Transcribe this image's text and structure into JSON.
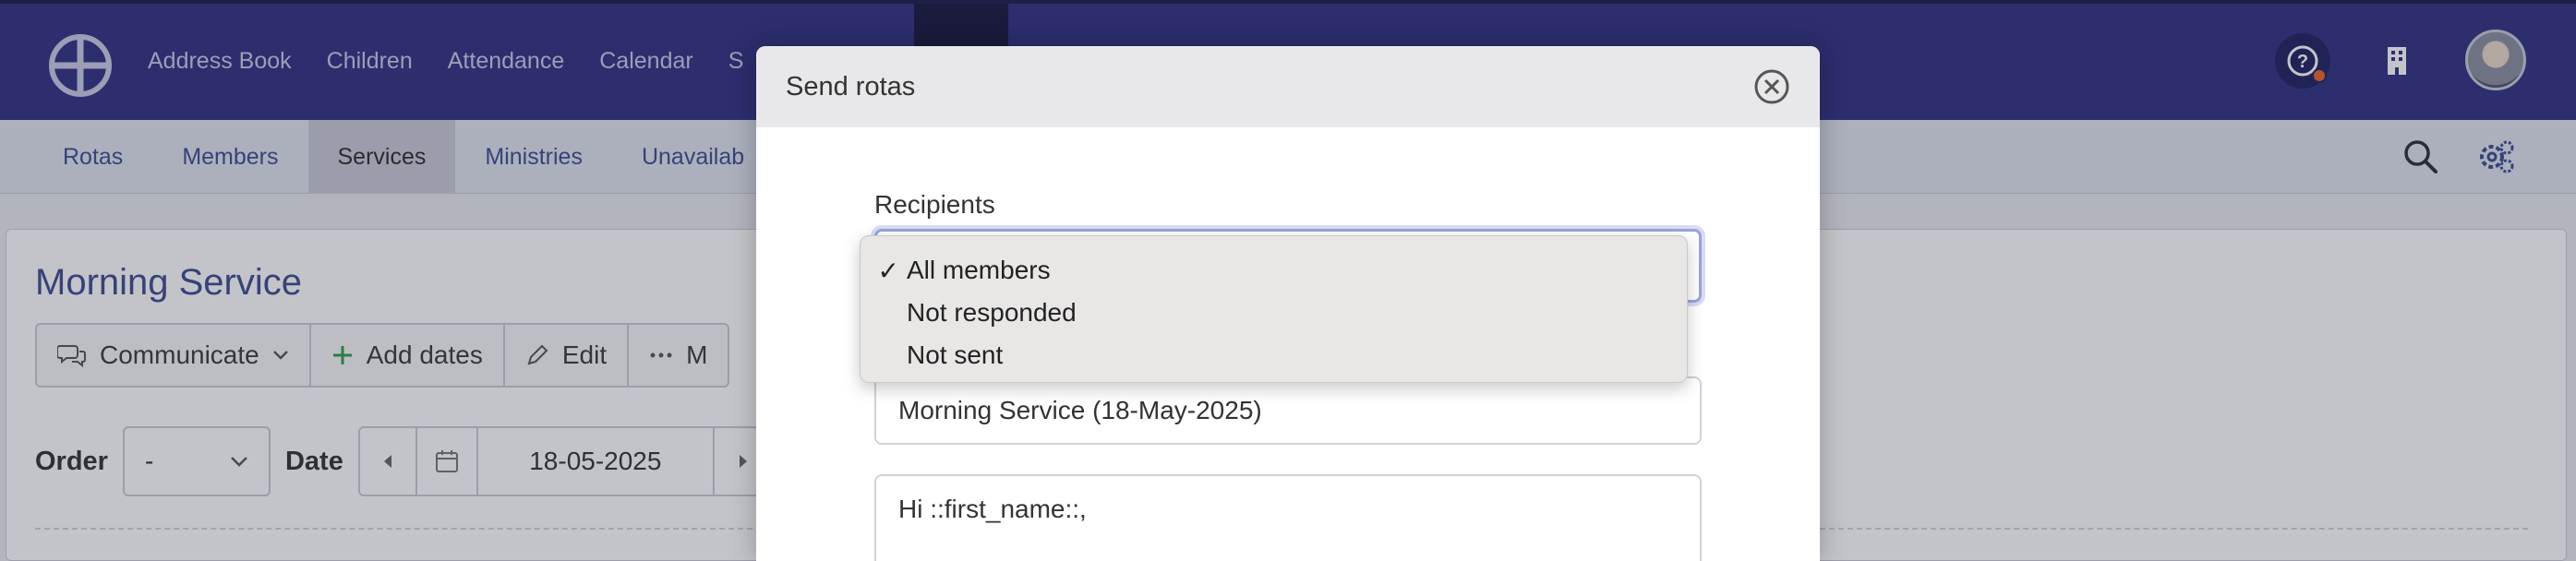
{
  "topnav": {
    "items": [
      "Address Book",
      "Children",
      "Attendance",
      "Calendar",
      "S"
    ]
  },
  "subnav": {
    "tabs": [
      "Rotas",
      "Members",
      "Services",
      "Ministries",
      "Unavailab"
    ],
    "active_index": 2
  },
  "page": {
    "title": "Morning Service",
    "toolbar": {
      "communicate": "Communicate",
      "add_dates": "Add dates",
      "edit": "Edit",
      "more": "M"
    },
    "filters": {
      "order_label": "Order",
      "order_value": "-",
      "date_label": "Date",
      "date_value": "18-05-2025"
    }
  },
  "modal": {
    "title": "Send rotas",
    "recipients_label": "Recipients",
    "recipients_options": [
      {
        "label": "All members",
        "selected": true
      },
      {
        "label": "Not responded",
        "selected": false
      },
      {
        "label": "Not sent",
        "selected": false
      }
    ],
    "check_mark": "✓",
    "subject_value": "Morning Service (18-May-2025)",
    "message_value": "Hi ::first_name::,"
  },
  "colors": {
    "navbar": "#2f3082",
    "accent_blue": "#3e4b8f",
    "notification_dot": "#e8652c",
    "add_icon_green": "#2e9d47"
  }
}
